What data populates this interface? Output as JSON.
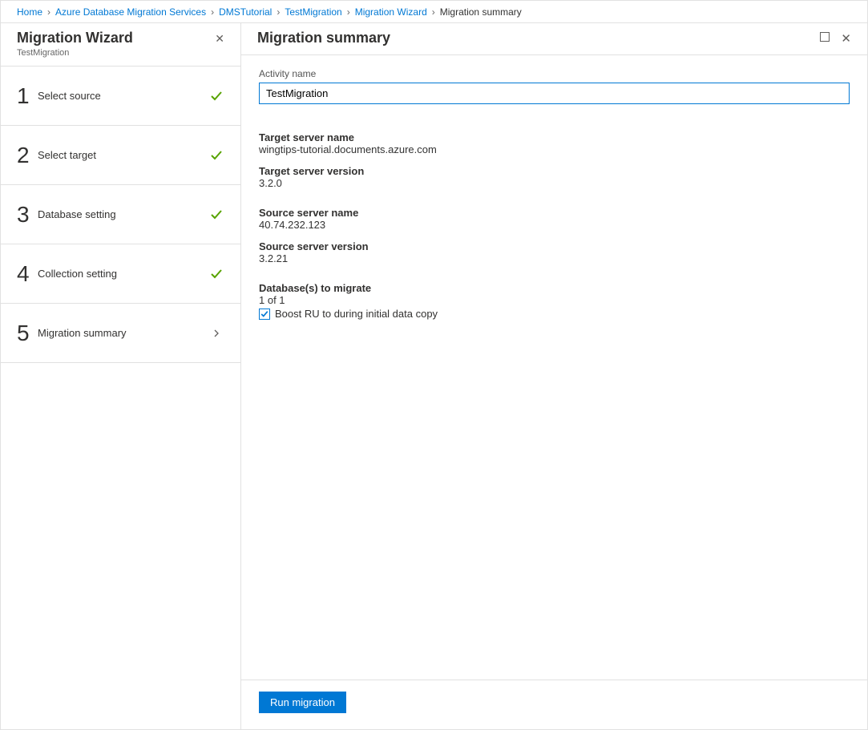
{
  "breadcrumb": {
    "links": [
      "Home",
      "Azure Database Migration Services",
      "DMSTutorial",
      "TestMigration",
      "Migration Wizard"
    ],
    "current": "Migration summary"
  },
  "sidebar": {
    "title": "Migration Wizard",
    "subtitle": "TestMigration",
    "steps": [
      {
        "num": "1",
        "label": "Select source",
        "state": "done"
      },
      {
        "num": "2",
        "label": "Select target",
        "state": "done"
      },
      {
        "num": "3",
        "label": "Database setting",
        "state": "done"
      },
      {
        "num": "4",
        "label": "Collection setting",
        "state": "done"
      },
      {
        "num": "5",
        "label": "Migration summary",
        "state": "current"
      }
    ]
  },
  "main": {
    "title": "Migration summary",
    "activity_name_label": "Activity name",
    "activity_name_value": "TestMigration",
    "target_server_name_label": "Target server name",
    "target_server_name_value": "wingtips-tutorial.documents.azure.com",
    "target_server_version_label": "Target server version",
    "target_server_version_value": "3.2.0",
    "source_server_name_label": "Source server name",
    "source_server_name_value": "40.74.232.123",
    "source_server_version_label": "Source server version",
    "source_server_version_value": "3.2.21",
    "databases_label": "Database(s) to migrate",
    "databases_value": "1 of 1",
    "boost_checkbox_label": "Boost RU to during initial data copy",
    "boost_checked": true,
    "run_button": "Run migration"
  }
}
